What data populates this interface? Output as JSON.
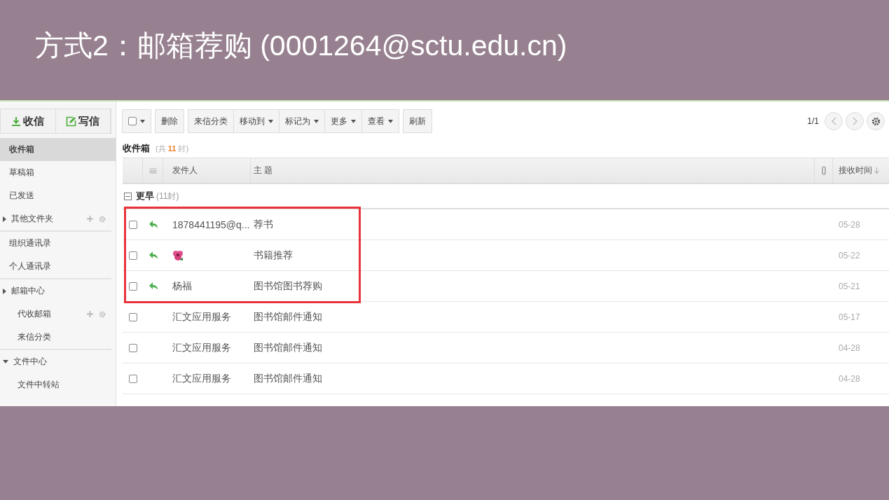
{
  "slide": {
    "title": "方式2：邮箱荐购 (0001264@sctu.edu.cn)"
  },
  "compose": [
    {
      "label": "收信",
      "kind": "receive"
    },
    {
      "label": "写信",
      "kind": "write"
    }
  ],
  "sidebar": {
    "groups": [
      [
        {
          "label": "收件箱",
          "kind": "item",
          "selected": true
        },
        {
          "label": "草稿箱",
          "kind": "item",
          "selected": false
        },
        {
          "label": "已发送",
          "kind": "item",
          "selected": false
        },
        {
          "label": "其他文件夹",
          "kind": "folder",
          "selected": false,
          "expanded": false,
          "actions": [
            {
              "kind": "add"
            },
            {
              "kind": "settings"
            }
          ]
        }
      ],
      [
        {
          "label": "组织通讯录",
          "kind": "item",
          "selected": false
        },
        {
          "label": "个人通讯录",
          "kind": "item",
          "selected": false
        }
      ],
      [
        {
          "label": "邮箱中心",
          "kind": "folder",
          "selected": false,
          "expanded": false
        },
        {
          "label": "代收邮箱",
          "kind": "subitem",
          "selected": false,
          "actions": [
            {
              "kind": "add"
            },
            {
              "kind": "settings"
            }
          ]
        },
        {
          "label": "来信分类",
          "kind": "subitem",
          "selected": false
        }
      ],
      [
        {
          "label": "文件中心",
          "kind": "folder",
          "selected": false,
          "expanded": true
        },
        {
          "label": "文件中转站",
          "kind": "subitem",
          "selected": false
        }
      ]
    ]
  },
  "toolbar": [
    [
      {
        "kind": "select",
        "checked": false
      }
    ],
    [
      {
        "label": "删除",
        "kind": "plain"
      }
    ],
    [
      {
        "label": "来信分类",
        "kind": "plain"
      },
      {
        "label": "移动到",
        "kind": "menu"
      },
      {
        "label": "标记为",
        "kind": "menu"
      },
      {
        "label": "更多",
        "kind": "menu"
      },
      {
        "label": "查看",
        "kind": "menu"
      }
    ],
    [
      {
        "label": "刷新",
        "kind": "plain"
      }
    ]
  ],
  "pager": {
    "label": "1/1"
  },
  "folder": {
    "title": "收件箱",
    "count_prefix": "(共",
    "count": "11",
    "count_suffix": "封)"
  },
  "table": {
    "columns": [
      "发件人",
      "主 题",
      "接收时间"
    ],
    "group": {
      "label": "更早",
      "count": "(11封)",
      "expanded": true
    },
    "highlighted_rows": [
      {
        "checked": false,
        "kind": "replied",
        "sender": "1878441195@q...",
        "subject": "荐书",
        "date": "05-28"
      },
      {
        "checked": false,
        "kind": "replied",
        "subject": "书籍推荐",
        "date": "05-22"
      },
      {
        "checked": false,
        "kind": "replied",
        "sender": "杨福",
        "subject": "图书馆图书荐购",
        "date": "05-21"
      }
    ],
    "rows": [
      {
        "checked": false,
        "sender": "汇文应用服务",
        "subject": "图书馆邮件通知",
        "date": "05-17"
      },
      {
        "checked": false,
        "sender": "汇文应用服务",
        "subject": "图书馆邮件通知",
        "date": "04-28"
      },
      {
        "checked": false,
        "sender": "汇文应用服务",
        "subject": "图书馆邮件通知",
        "date": "04-28"
      }
    ]
  }
}
